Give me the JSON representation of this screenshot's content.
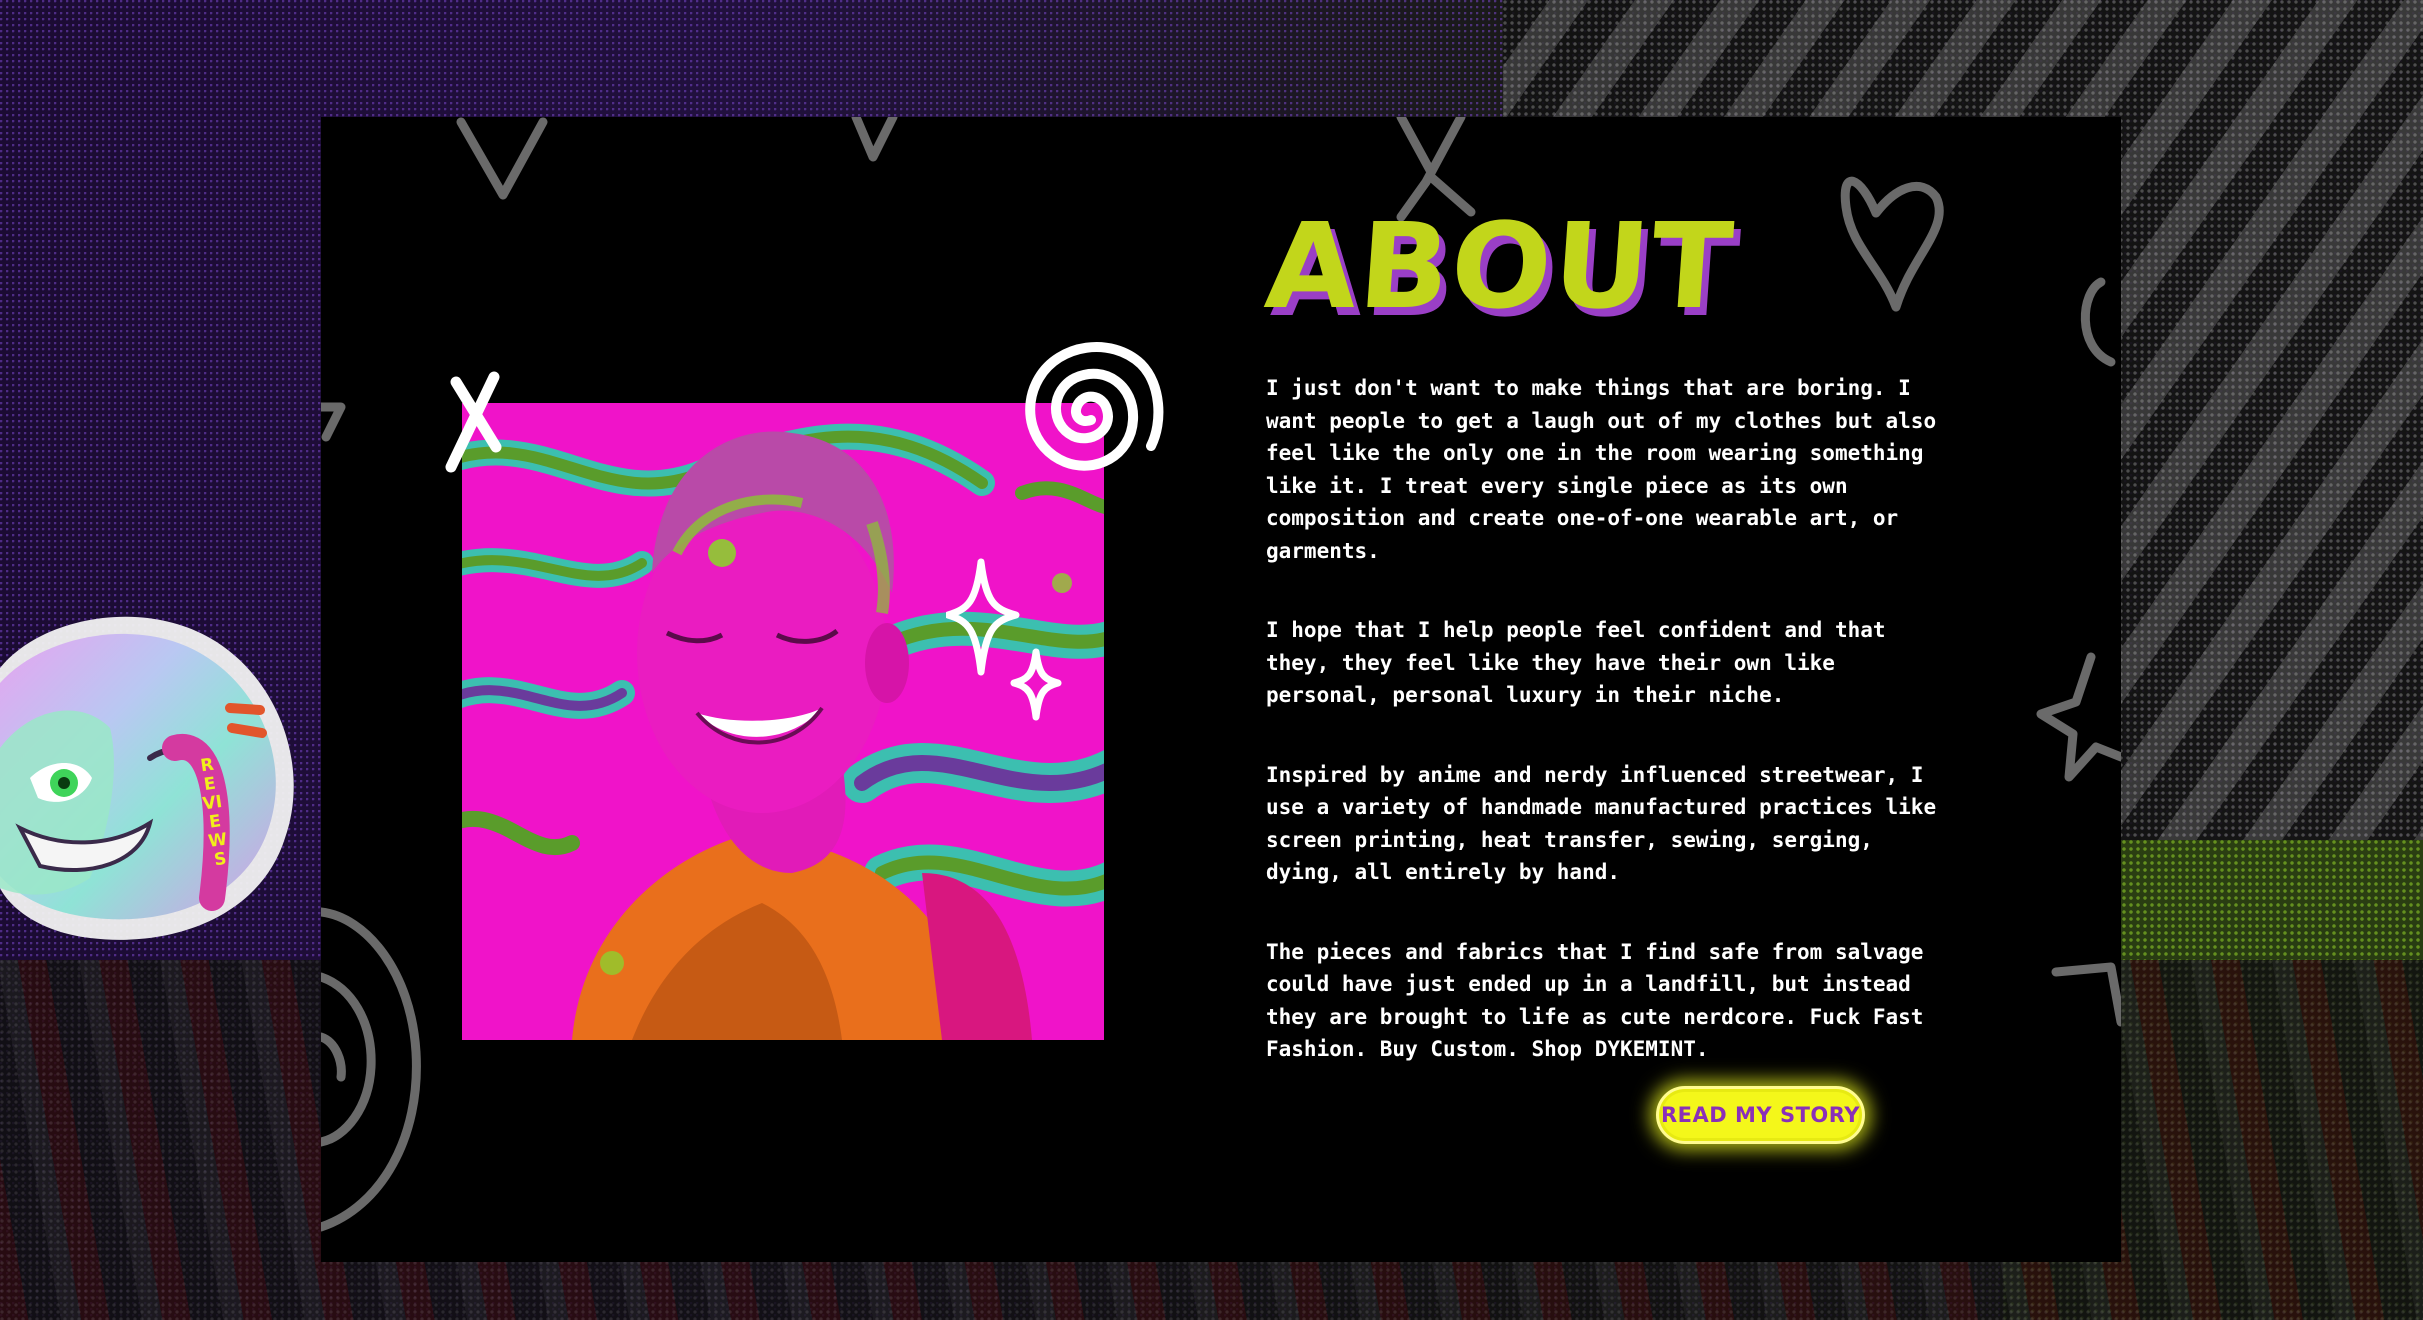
{
  "about": {
    "title": "ABOUT",
    "paragraphs": [
      "I just don't want to make things that are boring. I want people to get a laugh out of my clothes but also feel like the only one in the room wearing something like it. I treat every single piece as its own composition and create one-of-one wearable art, or garments.",
      "I hope that I help people feel confident and that they, they feel like they have their own like personal, personal luxury in their niche.",
      "Inspired by anime and nerdy influenced streetwear, I use a variety of handmade manufactured practices like screen printing, heat transfer, sewing, serging, dying, all entirely by hand.",
      "The pieces and fabrics that I find safe from salvage could have just ended up in a landfill, but instead they are brought to life as cute nerdcore. Fuck Fast Fashion. Buy Custom. Shop DYKEMINT."
    ],
    "cta_label": "READ MY STORY"
  },
  "reviews_badge": {
    "label": "REVIEWS"
  },
  "colors": {
    "accent_lime": "#c2d61b",
    "accent_purple": "#9a3fc6",
    "button_yellow": "#f4f71a",
    "photo_magenta": "#f013c9"
  },
  "icons": [
    "x-doodle-icon",
    "spiral-doodle-icon",
    "sparkle-icon",
    "heart-doodle-icon",
    "star-doodle-icon"
  ]
}
